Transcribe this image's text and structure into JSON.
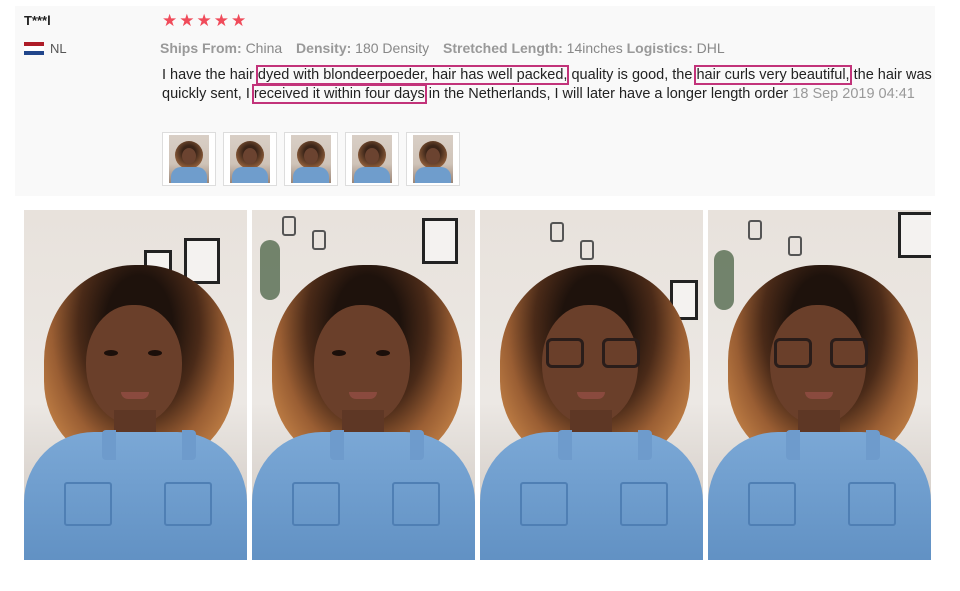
{
  "review": {
    "user": "T***l",
    "country": "NL",
    "rating": 5,
    "stars": [
      "★",
      "★",
      "★",
      "★",
      "★"
    ],
    "meta": {
      "ships_from_label": "Ships From:",
      "ships_from_value": "China",
      "density_label": "Density:",
      "density_value": "180 Density",
      "stretched_length_label": "Stretched Length:",
      "stretched_length_value": "14inches",
      "logistics_label": "Logistics:",
      "logistics_value": "DHL"
    },
    "text": {
      "t1": "I have the hair ",
      "h1": "dyed with blondeerpoeder, hair has well packed,",
      "t2": " quality is good, the ",
      "h2": "hair curls very beautiful,",
      "t3": " the hair was quickly sent, I ",
      "h3": "received it within four days",
      "t4": " in the Netherlands, I will later have a longer length order",
      "date": "18 Sep 2019 04:41"
    },
    "thumbnail_count": 5,
    "photo_count": 4
  },
  "colors": {
    "star": "#f04b5a",
    "highlight_border": "#c2337a",
    "card_background": "#f9f9f9",
    "muted_text": "#888888"
  },
  "icons": {
    "flag": "netherlands-flag-icon",
    "star": "star-icon"
  }
}
